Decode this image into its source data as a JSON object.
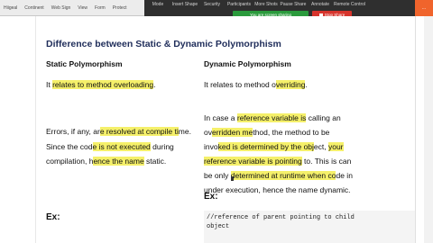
{
  "toolbar": {
    "left_items": [
      "Hiigeal",
      "Continent",
      "Web Sign",
      "View",
      "Form",
      "Protect"
    ],
    "right_items": [
      "Mode",
      "Insert Shape",
      "Security",
      "Participants",
      "More Shots",
      "Pause Share",
      "Annotate",
      "Remote Control"
    ],
    "tab_label": "...",
    "accent": "#f0642c"
  },
  "share": {
    "note": "You are screen sharing",
    "stop_label": "Stop Share",
    "note_color": "#2a9a3c",
    "stop_color": "#d6342c"
  },
  "doc": {
    "title": "Difference between Static & Dynamic Polymorphism",
    "col1_header": "Static Polymorphism",
    "col2_header": "Dynamic Polymorphism",
    "static1": {
      "pre": "It ",
      "hl": "relates to method overloading",
      "post": "."
    },
    "dynamic1": {
      "pre": "It relates to method o",
      "hl": "verriding",
      "post": "."
    },
    "static2": {
      "l1_pre": "Errors, if any, ar",
      "l1_hl": "e resolved at compile ti",
      "l1_post": "me.",
      "l2_pre": "Since the cod",
      "l2_hl": "e is not executed",
      "l2_post": " during",
      "l3_pre": "compilation, h",
      "l3_hl": "ence the name",
      "l3_post": " static."
    },
    "dynamic2": {
      "l1_pre": "In case a ",
      "l1_hl": "reference variable is",
      "l1_post": " calling an",
      "l2_pre": "ov",
      "l2_hl": "erridden me",
      "l2_post": "thod, the method to be",
      "l3_pre": "invo",
      "l3_hl": "ked is determined by the obj",
      "l3_mid": "ect, ",
      "l3_hl2": "your",
      "l4_hl": "reference variable is pointing",
      "l4_post": " to. This is can",
      "l5_pre": "be only ",
      "l5_hl": "determined at runtime when co",
      "l5_post": "de in",
      "l6": "under execution, hence the name dynamic."
    },
    "ex_left": "Ex:",
    "ex_right": "Ex:",
    "code_line1": "//reference of parent pointing to child",
    "code_line2": "object"
  }
}
